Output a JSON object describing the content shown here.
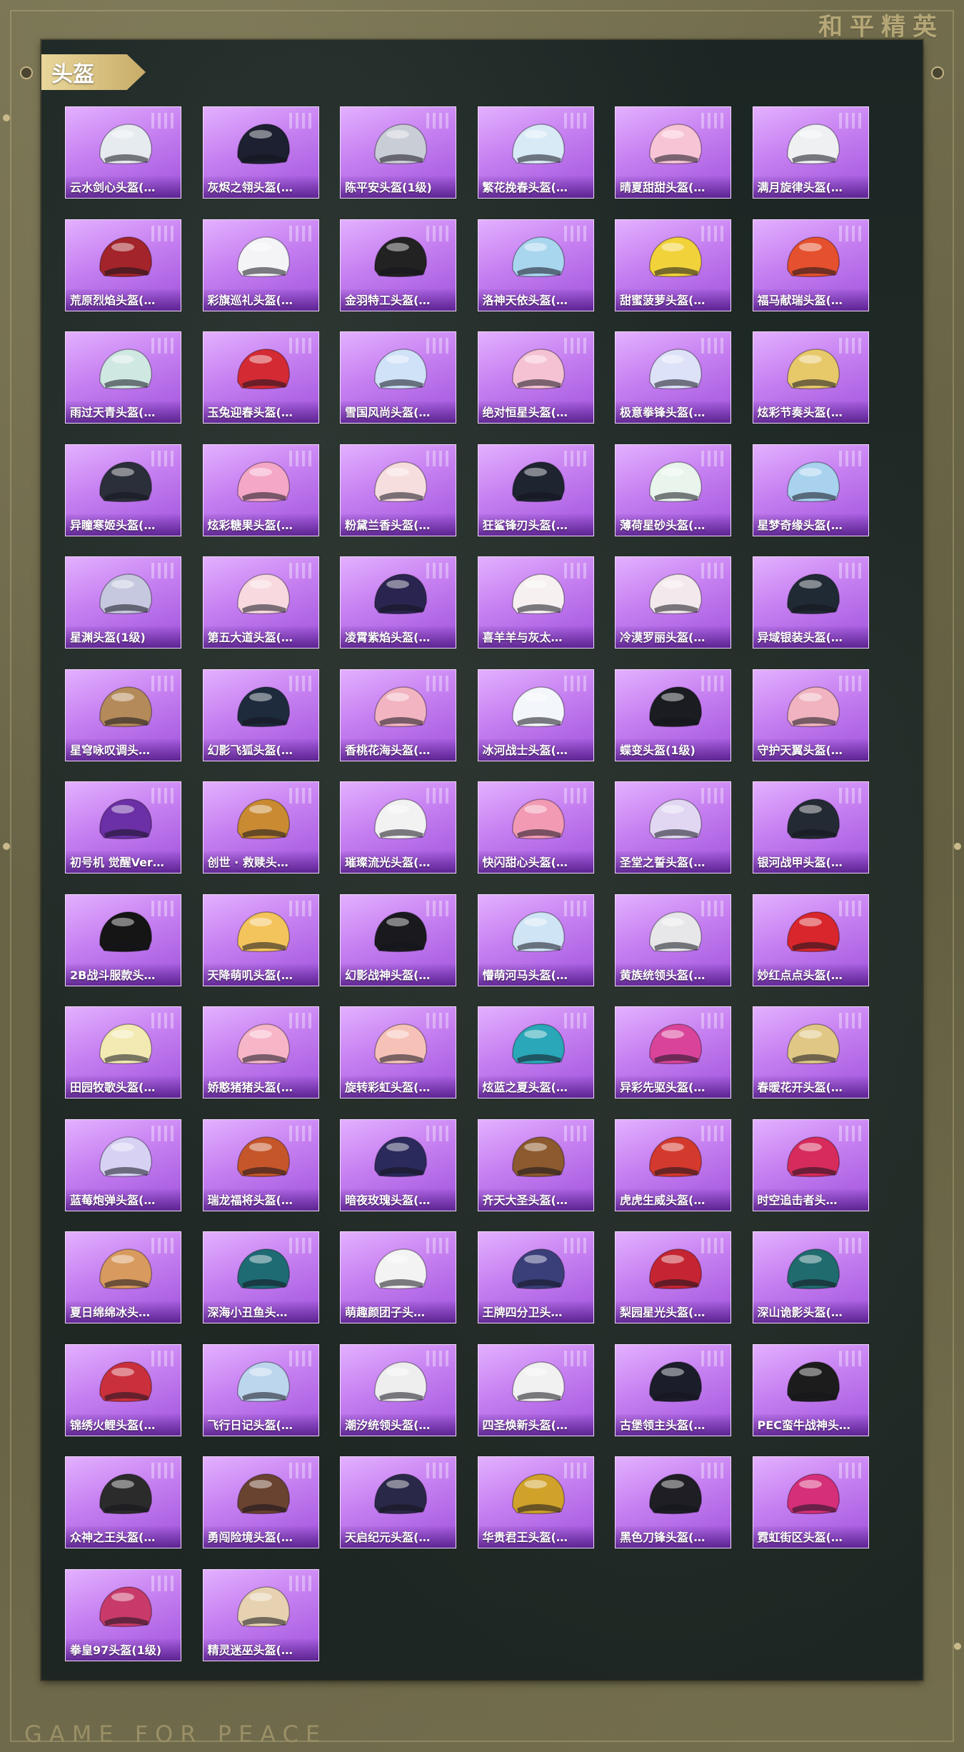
{
  "brand": {
    "top": "和平精英",
    "bottom": "GAME FOR PEACE"
  },
  "section": {
    "title": "头盔"
  },
  "items": [
    {
      "label": "云水剑心头盔(…",
      "color": "#e6ebef"
    },
    {
      "label": "灰烬之翎头盔(…",
      "color": "#1c2030"
    },
    {
      "label": "陈平安头盔(1级)",
      "color": "#c9cdd6"
    },
    {
      "label": "繁花挽春头盔(…",
      "color": "#d8eaf6"
    },
    {
      "label": "晴夏甜甜头盔(…",
      "color": "#f7c4d6"
    },
    {
      "label": "满月旋律头盔(…",
      "color": "#eef0f2"
    },
    {
      "label": "荒原烈焰头盔(…",
      "color": "#a3242a"
    },
    {
      "label": "彩旗巡礼头盔(…",
      "color": "#f4f4f7"
    },
    {
      "label": "金羽特工头盔(…",
      "color": "#222222"
    },
    {
      "label": "洛神天依头盔(…",
      "color": "#a9d6ef"
    },
    {
      "label": "甜蜜菠萝头盔(…",
      "color": "#f2d23a"
    },
    {
      "label": "福马献瑞头盔(…",
      "color": "#e5502e"
    },
    {
      "label": "雨过天青头盔(…",
      "color": "#cfe8e2"
    },
    {
      "label": "玉兔迎春头盔(…",
      "color": "#d42a33"
    },
    {
      "label": "雪国风尚头盔(…",
      "color": "#cfe2f7"
    },
    {
      "label": "绝对恒星头盔(…",
      "color": "#f5c2d3"
    },
    {
      "label": "极意拳锋头盔(…",
      "color": "#dde2f8"
    },
    {
      "label": "炫彩节奏头盔(…",
      "color": "#e7c96a"
    },
    {
      "label": "异瞳寒姬头盔(…",
      "color": "#2a2f3a"
    },
    {
      "label": "炫彩糖果头盔(…",
      "color": "#f4a7c7"
    },
    {
      "label": "粉黛兰香头盔(…",
      "color": "#f7dede"
    },
    {
      "label": "狂鲨锋刃头盔(…",
      "color": "#1e2430"
    },
    {
      "label": "薄荷星砂头盔(…",
      "color": "#e9f5ec"
    },
    {
      "label": "星梦奇缘头盔(…",
      "color": "#a8d2ee"
    },
    {
      "label": "星渊头盔(1级)",
      "color": "#c5c8de"
    },
    {
      "label": "第五大道头盔(…",
      "color": "#f8d9df"
    },
    {
      "label": "凌霄紫焰头盔(…",
      "color": "#2a2550"
    },
    {
      "label": "喜羊羊与灰太…",
      "color": "#f6f0f1"
    },
    {
      "label": "冷漠罗丽头盔(…",
      "color": "#f3e8ec"
    },
    {
      "label": "异域银装头盔(…",
      "color": "#1f2a34"
    },
    {
      "label": "星穹咏叹调头…",
      "color": "#b48a5a"
    },
    {
      "label": "幻影飞狐头盔(…",
      "color": "#1d2b3d"
    },
    {
      "label": "香桃花海头盔(…",
      "color": "#f2b4c1"
    },
    {
      "label": "冰河战士头盔(…",
      "color": "#f3f6fa"
    },
    {
      "label": "蝶变头盔(1级)",
      "color": "#1a1c22"
    },
    {
      "label": "守护天翼头盔(…",
      "color": "#f0b3bf"
    },
    {
      "label": "初号机 觉醒Ver…",
      "color": "#6b2fa6"
    },
    {
      "label": "创世 · 救赎头…",
      "color": "#c98a32"
    },
    {
      "label": "璀璨流光头盔(…",
      "color": "#f2f2f2"
    },
    {
      "label": "快闪甜心头盔(…",
      "color": "#f29ab4"
    },
    {
      "label": "圣堂之誓头盔(…",
      "color": "#e1d7f2"
    },
    {
      "label": "银河战甲头盔(…",
      "color": "#232a33"
    },
    {
      "label": "2B战斗服款头…",
      "color": "#151515"
    },
    {
      "label": "天降萌叽头盔(…",
      "color": "#f4c45c"
    },
    {
      "label": "幻影战神头盔(…",
      "color": "#1a1a1e"
    },
    {
      "label": "懵萌河马头盔(…",
      "color": "#cfe4f4"
    },
    {
      "label": "黄族统领头盔(…",
      "color": "#e7e7ea"
    },
    {
      "label": "妙红点点头盔(…",
      "color": "#d8262c"
    },
    {
      "label": "田园牧歌头盔(…",
      "color": "#f2eab2"
    },
    {
      "label": "娇憨猪猪头盔(…",
      "color": "#f7b6c8"
    },
    {
      "label": "旋转彩虹头盔(…",
      "color": "#f6c2b8"
    },
    {
      "label": "炫蓝之夏头盔(…",
      "color": "#2aa7b8"
    },
    {
      "label": "异彩先驱头盔(…",
      "color": "#d9449a"
    },
    {
      "label": "春暖花开头盔(…",
      "color": "#e0c785"
    },
    {
      "label": "蓝莓炮弹头盔(…",
      "color": "#d7d2f4"
    },
    {
      "label": "瑞龙福将头盔(…",
      "color": "#c5562a"
    },
    {
      "label": "暗夜玫瑰头盔(…",
      "color": "#2b2a5c"
    },
    {
      "label": "齐天大圣头盔(…",
      "color": "#8c5a2e"
    },
    {
      "label": "虎虎生威头盔(…",
      "color": "#d4392e"
    },
    {
      "label": "时空追击者头…",
      "color": "#d72b5c"
    },
    {
      "label": "夏日绵绵冰头…",
      "color": "#d89a5e"
    },
    {
      "label": "深海小丑鱼头…",
      "color": "#1e6b74"
    },
    {
      "label": "萌趣颜团子头…",
      "color": "#f3f3f3"
    },
    {
      "label": "王牌四分卫头…",
      "color": "#3a3f7a"
    },
    {
      "label": "梨园星光头盔(…",
      "color": "#c52532"
    },
    {
      "label": "深山诡影头盔(…",
      "color": "#1f6b6e"
    },
    {
      "label": "锦绣火鲤头盔(…",
      "color": "#c9303c"
    },
    {
      "label": "飞行日记头盔(…",
      "color": "#bcd6ee"
    },
    {
      "label": "潮汐统领头盔(…",
      "color": "#eeeeef"
    },
    {
      "label": "四圣焕新头盔(…",
      "color": "#f1f1f1"
    },
    {
      "label": "古堡领主头盔(…",
      "color": "#1b1e2a"
    },
    {
      "label": "PEC蛮牛战神头…",
      "color": "#1c1c1c"
    },
    {
      "label": "众神之王头盔(…",
      "color": "#2b2b2b"
    },
    {
      "label": "勇闯险境头盔(…",
      "color": "#6a4230"
    },
    {
      "label": "天启纪元头盔(…",
      "color": "#2a2848"
    },
    {
      "label": "华贵君王头盔(…",
      "color": "#d0a22a"
    },
    {
      "label": "黑色刀锋头盔(…",
      "color": "#1e1e24"
    },
    {
      "label": "霓虹街区头盔(…",
      "color": "#d52f7a"
    },
    {
      "label": "拳皇97头盔(1级)",
      "color": "#c83a6a"
    },
    {
      "label": "精灵迷巫头盔(…",
      "color": "#e6d2b0"
    }
  ]
}
